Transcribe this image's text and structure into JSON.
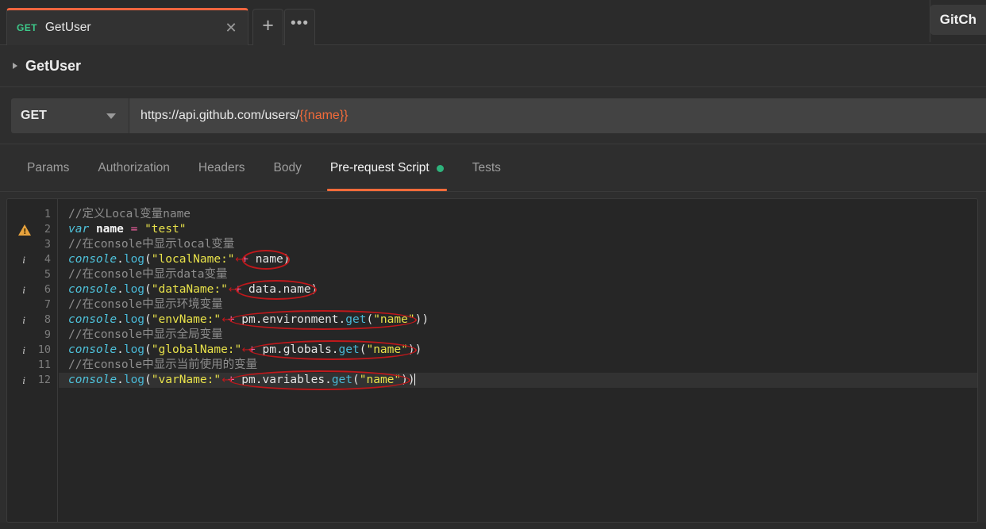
{
  "window": {
    "tab": {
      "method": "GET",
      "name": "GetUser",
      "close_icon": "close-icon"
    },
    "add_tab_label": "+",
    "more_tabs_label": "•••",
    "top_right_chip": "GitCh"
  },
  "breadcrumb": {
    "caret_icon": "triangle-right-icon",
    "label": "GetUser"
  },
  "request": {
    "method": "GET",
    "method_caret_icon": "chevron-down-icon",
    "url_prefix": "https://api.github.com/users/",
    "url_variable": "{{name}}",
    "url_full": "https://api.github.com/users/{{name}}"
  },
  "section_tabs": [
    {
      "label": "Params",
      "active": false,
      "dot": false
    },
    {
      "label": "Authorization",
      "active": false,
      "dot": false
    },
    {
      "label": "Headers",
      "active": false,
      "dot": false
    },
    {
      "label": "Body",
      "active": false,
      "dot": false
    },
    {
      "label": "Pre-request Script",
      "active": true,
      "dot": true
    },
    {
      "label": "Tests",
      "active": false,
      "dot": false
    }
  ],
  "editor": {
    "active_line": 12,
    "gutter": {
      "numbers": [
        1,
        2,
        3,
        4,
        5,
        6,
        7,
        8,
        9,
        10,
        11,
        12
      ],
      "warning_lines": [
        2
      ],
      "info_lines": [
        4,
        6,
        8,
        10,
        12
      ],
      "warning_icon": "warning-triangle-icon",
      "info_icon": "info-icon"
    },
    "lines": [
      {
        "n": 1,
        "text": "//定义Local变量name"
      },
      {
        "n": 2,
        "text": "var name = \"test\""
      },
      {
        "n": 3,
        "text": "//在console中显示local变量"
      },
      {
        "n": 4,
        "text": "console.log(\"localName:\" + name)"
      },
      {
        "n": 5,
        "text": "//在console中显示data变量"
      },
      {
        "n": 6,
        "text": "console.log(\"dataName:\" + data.name)"
      },
      {
        "n": 7,
        "text": "//在console中显示环境变量"
      },
      {
        "n": 8,
        "text": "console.log(\"envName:\" + pm.environment.get(\"name\"))"
      },
      {
        "n": 9,
        "text": "//在console中显示全局变量"
      },
      {
        "n": 10,
        "text": "console.log(\"globalName:\" + pm.globals.get(\"name\"))"
      },
      {
        "n": 11,
        "text": "//在console中显示当前使用的变量"
      },
      {
        "n": 12,
        "text": "console.log(\"varName:\" + pm.variables.get(\"name\"))"
      }
    ],
    "annotations": [
      {
        "line": 4,
        "target": "name)"
      },
      {
        "line": 6,
        "target": "data.name)"
      },
      {
        "line": 8,
        "target": "pm.environment.get(\"name\")"
      },
      {
        "line": 10,
        "target": "pm.globals.get(\"name\"))"
      },
      {
        "line": 12,
        "target": "pm.variables.get(\"name\"))"
      }
    ]
  },
  "colors": {
    "accent_orange": "#f26b3a",
    "verb_green": "#3dc98a",
    "dot_green": "#2eb37c",
    "annotation_red": "#c0181b",
    "warning_amber": "#e8a33d",
    "editor_bg": "#262626",
    "panel_bg": "#2e2e2e"
  }
}
